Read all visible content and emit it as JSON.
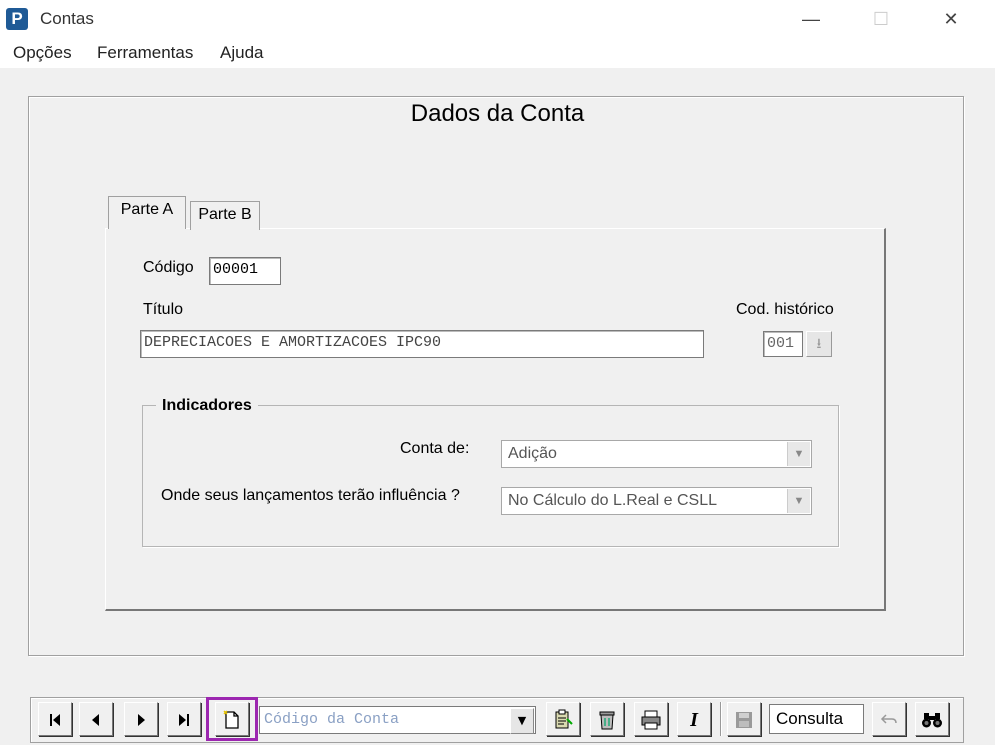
{
  "window": {
    "app_icon_letter": "P",
    "title": "Contas",
    "minimize": "—",
    "maximize": "☐",
    "close": "✕"
  },
  "menu": [
    "Opções",
    "Ferramentas",
    "Ajuda"
  ],
  "page_title": "Dados da Conta",
  "tabs": [
    "Parte A",
    "Parte B"
  ],
  "form": {
    "codigo_label": "Código",
    "codigo_value": "00001",
    "titulo_label": "Título",
    "titulo_value": "DEPRECIACOES E AMORTIZACOES IPC90",
    "cod_historico_label": "Cod. histórico",
    "cod_historico_value": "001"
  },
  "indicadores": {
    "title": "Indicadores",
    "conta_de_label": "Conta de:",
    "conta_de_value": "Adição",
    "influencia_label": "Onde seus lançamentos terão influência ?",
    "influencia_value": "No Cálculo do L.Real e CSLL"
  },
  "toolbar": {
    "first": "⏮",
    "prev": "◀",
    "next": "▶",
    "last": "⏭",
    "search_placeholder": "Código da Conta",
    "status": "Consulta",
    "italic": "I"
  },
  "colors": {
    "highlight": "#9c27b0"
  }
}
